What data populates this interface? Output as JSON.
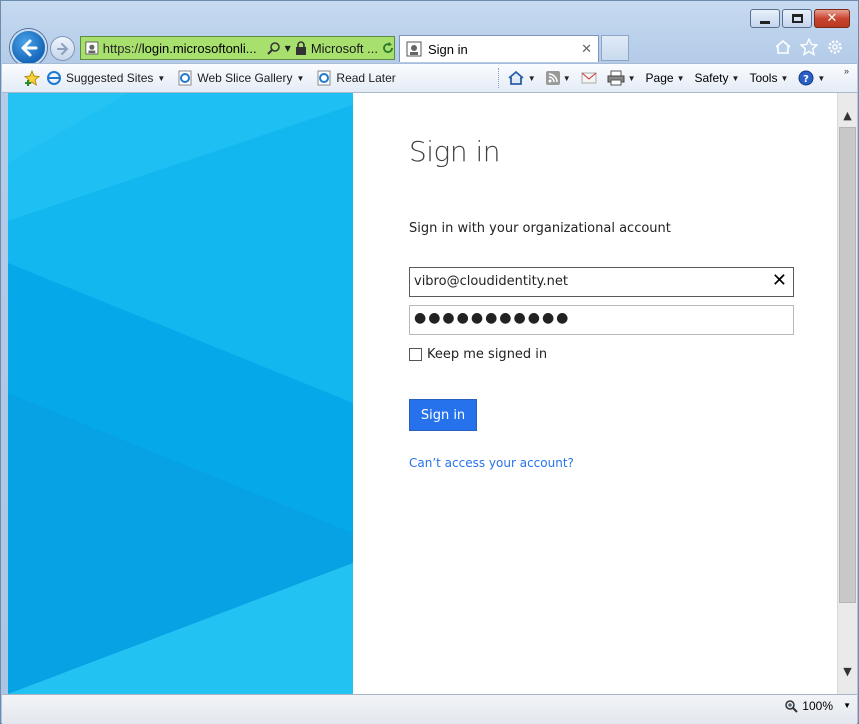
{
  "browser": {
    "address_url_prefix": "https://",
    "address_url_domain": "login.microsoftonli...",
    "site_identity": "Microsoft ...",
    "tab_title": "Sign in"
  },
  "favorites_bar": {
    "items": [
      {
        "label": "Suggested Sites"
      },
      {
        "label": "Web Slice Gallery"
      },
      {
        "label": "Read Later"
      }
    ]
  },
  "command_bar": {
    "page_label": "Page",
    "safety_label": "Safety",
    "tools_label": "Tools"
  },
  "signin": {
    "title": "Sign in",
    "subtitle": "Sign in with your organizational account",
    "email_value": "vibro@cloudidentity.net",
    "password_mask": "●●●●●●●●●●●",
    "keep_signed_in_label": "Keep me signed in",
    "keep_signed_in_checked": false,
    "button_label": "Sign in",
    "help_link": "Can’t access your account?"
  },
  "status_bar": {
    "zoom": "100%"
  },
  "colors": {
    "accent_button": "#2672ec",
    "panel_blue": "#0aaeea",
    "address_bar_green": "#a8e06e"
  }
}
